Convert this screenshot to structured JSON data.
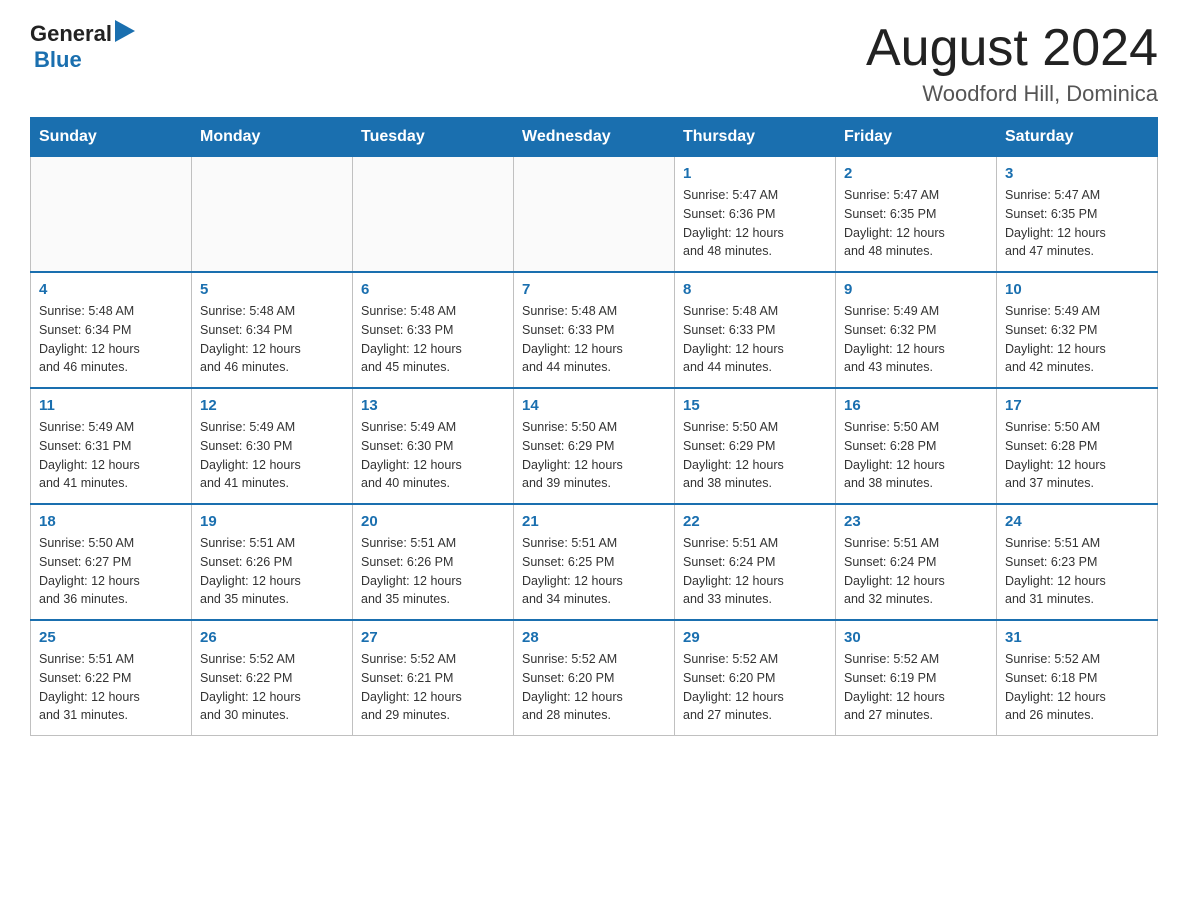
{
  "header": {
    "logo_general": "General",
    "logo_blue": "Blue",
    "month_title": "August 2024",
    "location": "Woodford Hill, Dominica"
  },
  "days_of_week": [
    "Sunday",
    "Monday",
    "Tuesday",
    "Wednesday",
    "Thursday",
    "Friday",
    "Saturday"
  ],
  "weeks": [
    [
      {
        "day": "",
        "info": ""
      },
      {
        "day": "",
        "info": ""
      },
      {
        "day": "",
        "info": ""
      },
      {
        "day": "",
        "info": ""
      },
      {
        "day": "1",
        "info": "Sunrise: 5:47 AM\nSunset: 6:36 PM\nDaylight: 12 hours\nand 48 minutes."
      },
      {
        "day": "2",
        "info": "Sunrise: 5:47 AM\nSunset: 6:35 PM\nDaylight: 12 hours\nand 48 minutes."
      },
      {
        "day": "3",
        "info": "Sunrise: 5:47 AM\nSunset: 6:35 PM\nDaylight: 12 hours\nand 47 minutes."
      }
    ],
    [
      {
        "day": "4",
        "info": "Sunrise: 5:48 AM\nSunset: 6:34 PM\nDaylight: 12 hours\nand 46 minutes."
      },
      {
        "day": "5",
        "info": "Sunrise: 5:48 AM\nSunset: 6:34 PM\nDaylight: 12 hours\nand 46 minutes."
      },
      {
        "day": "6",
        "info": "Sunrise: 5:48 AM\nSunset: 6:33 PM\nDaylight: 12 hours\nand 45 minutes."
      },
      {
        "day": "7",
        "info": "Sunrise: 5:48 AM\nSunset: 6:33 PM\nDaylight: 12 hours\nand 44 minutes."
      },
      {
        "day": "8",
        "info": "Sunrise: 5:48 AM\nSunset: 6:33 PM\nDaylight: 12 hours\nand 44 minutes."
      },
      {
        "day": "9",
        "info": "Sunrise: 5:49 AM\nSunset: 6:32 PM\nDaylight: 12 hours\nand 43 minutes."
      },
      {
        "day": "10",
        "info": "Sunrise: 5:49 AM\nSunset: 6:32 PM\nDaylight: 12 hours\nand 42 minutes."
      }
    ],
    [
      {
        "day": "11",
        "info": "Sunrise: 5:49 AM\nSunset: 6:31 PM\nDaylight: 12 hours\nand 41 minutes."
      },
      {
        "day": "12",
        "info": "Sunrise: 5:49 AM\nSunset: 6:30 PM\nDaylight: 12 hours\nand 41 minutes."
      },
      {
        "day": "13",
        "info": "Sunrise: 5:49 AM\nSunset: 6:30 PM\nDaylight: 12 hours\nand 40 minutes."
      },
      {
        "day": "14",
        "info": "Sunrise: 5:50 AM\nSunset: 6:29 PM\nDaylight: 12 hours\nand 39 minutes."
      },
      {
        "day": "15",
        "info": "Sunrise: 5:50 AM\nSunset: 6:29 PM\nDaylight: 12 hours\nand 38 minutes."
      },
      {
        "day": "16",
        "info": "Sunrise: 5:50 AM\nSunset: 6:28 PM\nDaylight: 12 hours\nand 38 minutes."
      },
      {
        "day": "17",
        "info": "Sunrise: 5:50 AM\nSunset: 6:28 PM\nDaylight: 12 hours\nand 37 minutes."
      }
    ],
    [
      {
        "day": "18",
        "info": "Sunrise: 5:50 AM\nSunset: 6:27 PM\nDaylight: 12 hours\nand 36 minutes."
      },
      {
        "day": "19",
        "info": "Sunrise: 5:51 AM\nSunset: 6:26 PM\nDaylight: 12 hours\nand 35 minutes."
      },
      {
        "day": "20",
        "info": "Sunrise: 5:51 AM\nSunset: 6:26 PM\nDaylight: 12 hours\nand 35 minutes."
      },
      {
        "day": "21",
        "info": "Sunrise: 5:51 AM\nSunset: 6:25 PM\nDaylight: 12 hours\nand 34 minutes."
      },
      {
        "day": "22",
        "info": "Sunrise: 5:51 AM\nSunset: 6:24 PM\nDaylight: 12 hours\nand 33 minutes."
      },
      {
        "day": "23",
        "info": "Sunrise: 5:51 AM\nSunset: 6:24 PM\nDaylight: 12 hours\nand 32 minutes."
      },
      {
        "day": "24",
        "info": "Sunrise: 5:51 AM\nSunset: 6:23 PM\nDaylight: 12 hours\nand 31 minutes."
      }
    ],
    [
      {
        "day": "25",
        "info": "Sunrise: 5:51 AM\nSunset: 6:22 PM\nDaylight: 12 hours\nand 31 minutes."
      },
      {
        "day": "26",
        "info": "Sunrise: 5:52 AM\nSunset: 6:22 PM\nDaylight: 12 hours\nand 30 minutes."
      },
      {
        "day": "27",
        "info": "Sunrise: 5:52 AM\nSunset: 6:21 PM\nDaylight: 12 hours\nand 29 minutes."
      },
      {
        "day": "28",
        "info": "Sunrise: 5:52 AM\nSunset: 6:20 PM\nDaylight: 12 hours\nand 28 minutes."
      },
      {
        "day": "29",
        "info": "Sunrise: 5:52 AM\nSunset: 6:20 PM\nDaylight: 12 hours\nand 27 minutes."
      },
      {
        "day": "30",
        "info": "Sunrise: 5:52 AM\nSunset: 6:19 PM\nDaylight: 12 hours\nand 27 minutes."
      },
      {
        "day": "31",
        "info": "Sunrise: 5:52 AM\nSunset: 6:18 PM\nDaylight: 12 hours\nand 26 minutes."
      }
    ]
  ]
}
